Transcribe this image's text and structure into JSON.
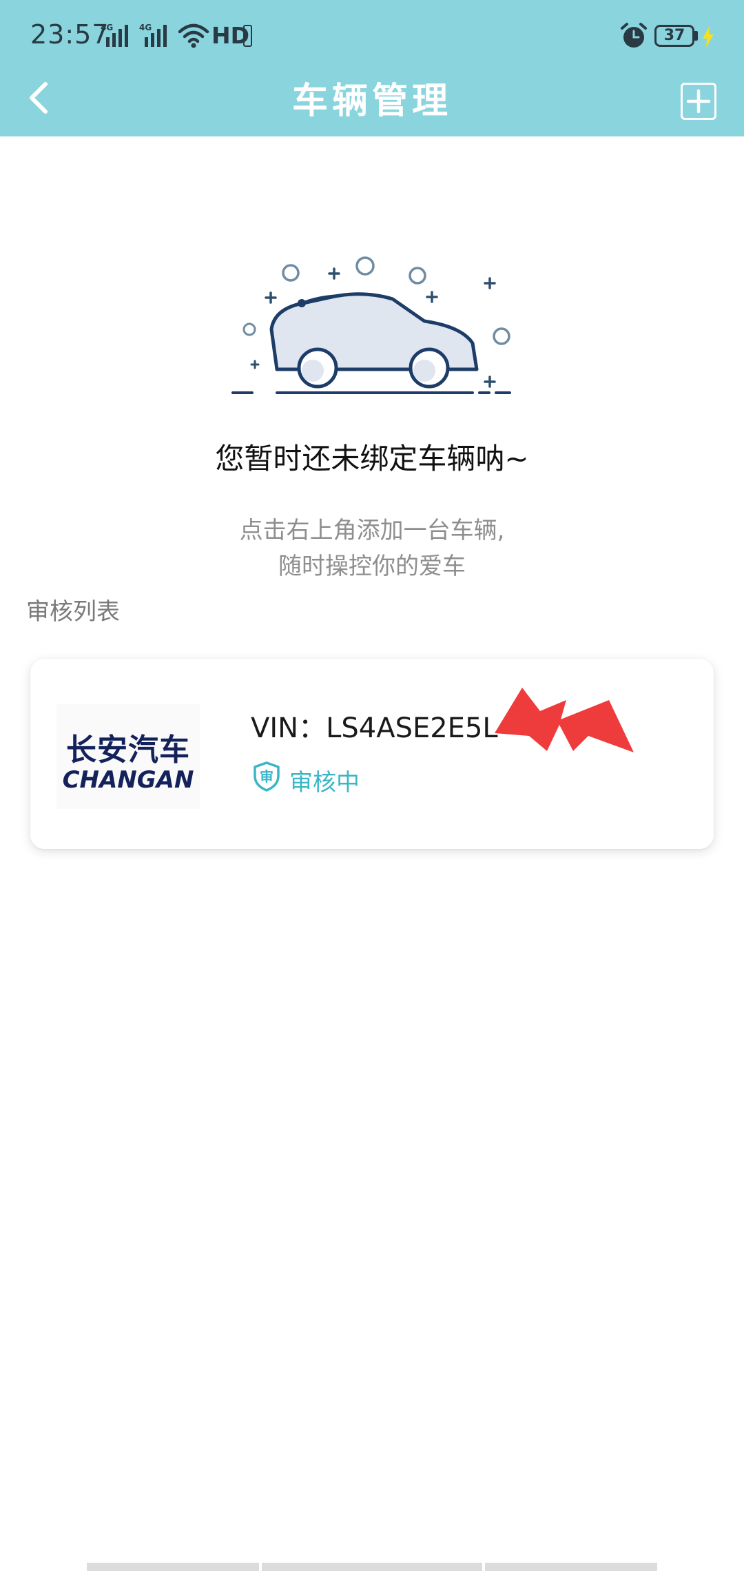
{
  "status_bar": {
    "time": "23:57",
    "network_1": "4G",
    "network_2": "4G",
    "hd": "HD",
    "battery": "37",
    "icons": [
      "signal-icon",
      "signal-icon",
      "wifi-icon",
      "alarm-icon",
      "battery-icon",
      "charging-icon"
    ]
  },
  "header": {
    "title": "车辆管理",
    "back_icon": "chevron-left-icon",
    "add_icon": "plus-square-icon",
    "background_color": "#89D4DD"
  },
  "empty_state": {
    "illustration": "car-illustration",
    "title": "您暂时还未绑定车辆呐~",
    "hint_line1": "点击右上角添加一台车辆,",
    "hint_line2": "随时操控你的爱车"
  },
  "review_section": {
    "title": "审核列表",
    "items": [
      {
        "brand_cn": "长安汽车",
        "brand_en": "CHANGAN",
        "vin": "VIN：LS4ASE2E5L",
        "status": "审核中",
        "status_icon": "review-shield-icon",
        "status_color": "#3bb6c6"
      }
    ]
  },
  "colors": {
    "accent": "#3bb6c6",
    "brand_navy": "#14225c",
    "redaction": "#ee3b3b"
  }
}
